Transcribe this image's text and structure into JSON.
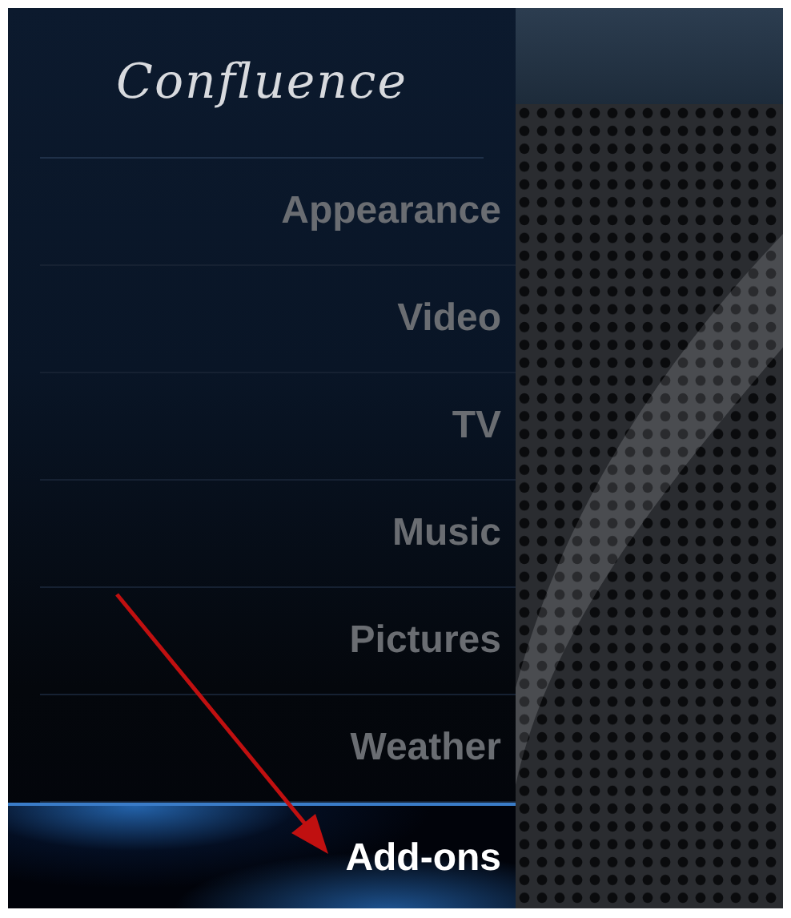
{
  "logo": {
    "text": "Confluence"
  },
  "menu": [
    {
      "label": "Appearance",
      "selected": false
    },
    {
      "label": "Video",
      "selected": false
    },
    {
      "label": "TV",
      "selected": false
    },
    {
      "label": "Music",
      "selected": false
    },
    {
      "label": "Pictures",
      "selected": false
    },
    {
      "label": "Weather",
      "selected": false
    },
    {
      "label": "Add-ons",
      "selected": true
    }
  ]
}
